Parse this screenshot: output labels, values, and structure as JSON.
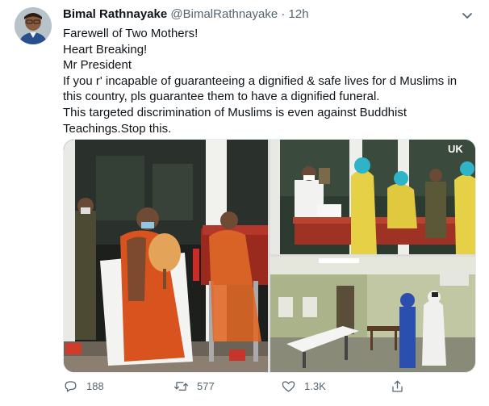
{
  "tweet": {
    "author_name": "Bimal Rathnayake",
    "author_handle": "@BimalRathnayake",
    "separator": "·",
    "time": "12h",
    "lines": [
      "Farewell of Two Mothers!",
      "Heart Breaking!",
      "Mr President",
      "If you r' incapable of guaranteeing a dignified & safe lives for d Muslims in",
      "this country, pls guarantee them to have a dignified funeral.",
      "This targeted discrimination of Muslims is even against Buddhist",
      "Teachings.Stop this."
    ],
    "media_watermark": "UK"
  },
  "actions": {
    "reply_count": "188",
    "retweet_count": "577",
    "like_count": "1.3K"
  },
  "icons": {
    "menu": "chevron-down-icon",
    "reply": "reply-icon",
    "retweet": "retweet-icon",
    "like": "heart-icon",
    "share": "share-icon"
  },
  "colors": {
    "text": "#0f1419",
    "secondary": "#536471"
  }
}
